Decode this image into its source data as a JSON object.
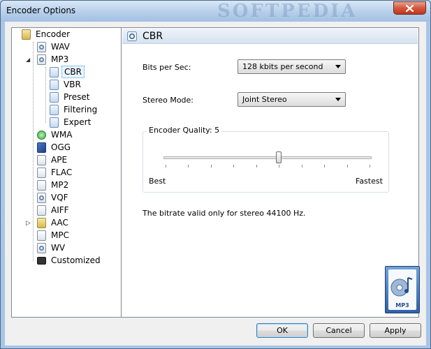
{
  "window": {
    "title": "Encoder Options",
    "watermark": "SOFTPEDIA"
  },
  "tree": {
    "root": "Encoder",
    "items": [
      {
        "label": "WAV",
        "icon": "wav-file-icon"
      },
      {
        "label": "MP3",
        "icon": "mp3-file-icon",
        "expanded": true
      },
      {
        "label": "CBR",
        "icon": "cbr-settings-icon",
        "selected": true
      },
      {
        "label": "VBR",
        "icon": "vbr-settings-icon"
      },
      {
        "label": "Preset",
        "icon": "preset-settings-icon"
      },
      {
        "label": "Filtering",
        "icon": "filtering-settings-icon"
      },
      {
        "label": "Expert",
        "icon": "expert-settings-icon"
      },
      {
        "label": "WMA",
        "icon": "wma-file-icon"
      },
      {
        "label": "OGG",
        "icon": "ogg-file-icon"
      },
      {
        "label": "APE",
        "icon": "ape-file-icon"
      },
      {
        "label": "FLAC",
        "icon": "flac-file-icon"
      },
      {
        "label": "MP2",
        "icon": "mp2-file-icon"
      },
      {
        "label": "VQF",
        "icon": "vqf-file-icon"
      },
      {
        "label": "AIFF",
        "icon": "aiff-file-icon"
      },
      {
        "label": "AAC",
        "icon": "aac-file-icon",
        "collapsed": true
      },
      {
        "label": "MPC",
        "icon": "mpc-file-icon"
      },
      {
        "label": "WV",
        "icon": "wv-file-icon"
      },
      {
        "label": "Customized",
        "icon": "customized-icon"
      }
    ]
  },
  "panel": {
    "title": "CBR",
    "bits_label": "Bits per Sec:",
    "bits_value": "128 kbits per second",
    "stereo_label": "Stereo Mode:",
    "stereo_value": "Joint Stereo",
    "quality_label": "Encoder Quality: 5",
    "quality_value": 5,
    "quality_min_label": "Best",
    "quality_max_label": "Fastest",
    "note": "The bitrate valid only for stereo 44100 Hz.",
    "logo_text": "MP3"
  },
  "buttons": {
    "ok": "OK",
    "cancel": "Cancel",
    "apply": "Apply"
  }
}
